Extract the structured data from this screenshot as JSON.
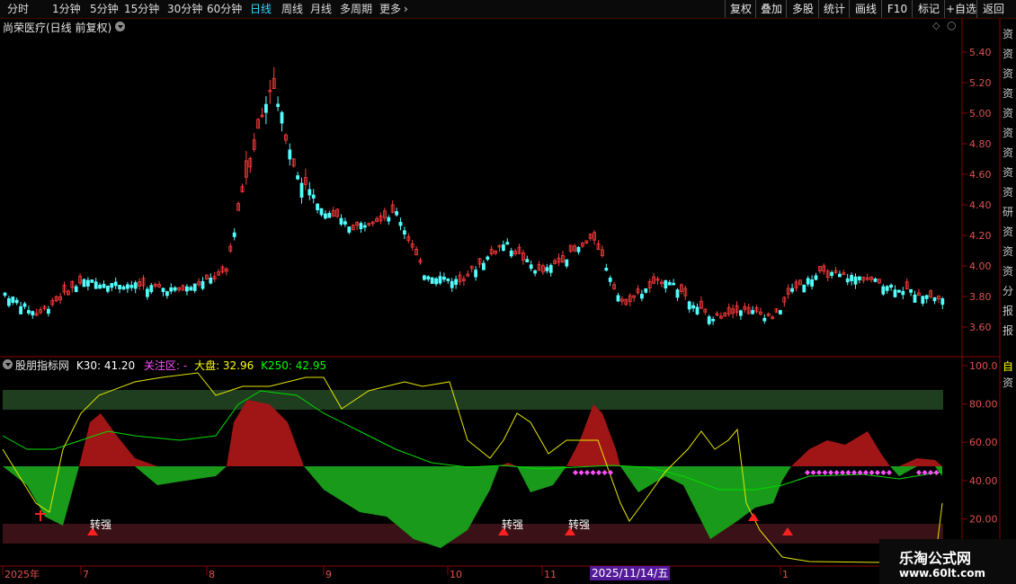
{
  "toolbar": {
    "period_tabs": [
      {
        "label": "分时",
        "active": false
      },
      {
        "label": "1分钟",
        "active": false
      },
      {
        "label": "5分钟",
        "active": false
      },
      {
        "label": "15分钟",
        "active": false
      },
      {
        "label": "30分钟",
        "active": false
      },
      {
        "label": "60分钟",
        "active": false
      },
      {
        "label": "日线",
        "active": true
      },
      {
        "label": "周线",
        "active": false
      },
      {
        "label": "月线",
        "active": false
      },
      {
        "label": "多周期",
        "active": false
      },
      {
        "label": "更多",
        "active": false
      }
    ],
    "more_icon": "chevron-right-icon",
    "right_buttons": [
      "复权",
      "叠加",
      "多股",
      "统计",
      "画线",
      "F10",
      "标记",
      "+自选",
      "返回"
    ]
  },
  "main_chart": {
    "title": "尚荣医疗(日线 前复权)",
    "dropdown_icon": "chevron-down-icon",
    "price_axis": [
      "5.40",
      "5.20",
      "5.00",
      "4.80",
      "4.60",
      "4.40",
      "4.20",
      "4.00",
      "3.80",
      "3.60"
    ]
  },
  "indicator": {
    "name": "股朋指标网",
    "k30": "K30: 41.20",
    "focus": "关注区: -",
    "market": "大盘: 32.96",
    "k250": "K250: 42.95",
    "axis": [
      "100.0",
      "80.00",
      "60.00",
      "40.00",
      "20.00"
    ],
    "signal_labels": [
      "转强",
      "转强",
      "转强"
    ]
  },
  "time_axis": {
    "labels": [
      "2025年",
      "7",
      "8",
      "9",
      "10",
      "11",
      "1"
    ],
    "cursor": "2025/11/14/五"
  },
  "side_strip": {
    "top_chars": [
      "资",
      "资",
      "资",
      "资",
      "资",
      "资",
      "资",
      "资",
      "资",
      "研",
      "资",
      "资",
      "资",
      "分",
      "报",
      "报"
    ],
    "lower_chars": [
      "自",
      "资"
    ]
  },
  "watermark": {
    "line1": "乐淘公式网",
    "line2": "www.60lt.com"
  },
  "colors": {
    "up": "#ff3c3c",
    "down": "#54fcfc",
    "active_tab": "#33d8ff",
    "k30": "#ffffff",
    "focus": "#ff50ff",
    "market": "#ffff00",
    "k250": "#00ff00"
  }
}
